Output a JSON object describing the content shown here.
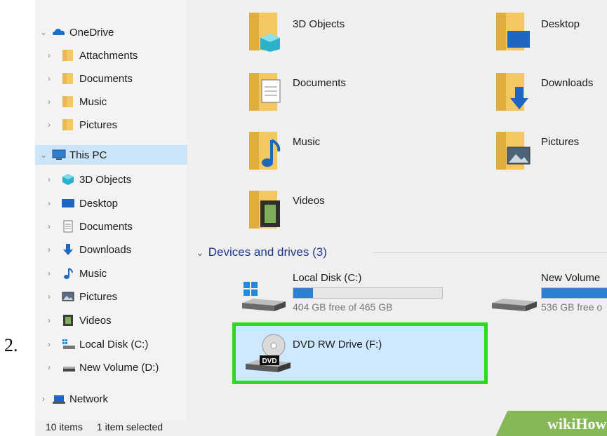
{
  "step_number": "2.",
  "nav": {
    "onedrive": "OneDrive",
    "onedrive_items": [
      "Attachments",
      "Documents",
      "Music",
      "Pictures"
    ],
    "this_pc": "This PC",
    "this_pc_items": [
      "3D Objects",
      "Desktop",
      "Documents",
      "Downloads",
      "Music",
      "Pictures",
      "Videos",
      "Local Disk (C:)",
      "New Volume (D:)"
    ],
    "network": "Network"
  },
  "status": {
    "items": "10 items",
    "selected": "1 item selected"
  },
  "folders": [
    {
      "name": "3D Objects"
    },
    {
      "name": "Desktop"
    },
    {
      "name": "Documents"
    },
    {
      "name": "Downloads"
    },
    {
      "name": "Music"
    },
    {
      "name": "Pictures"
    },
    {
      "name": "Videos"
    }
  ],
  "devices": {
    "header": "Devices and drives (3)",
    "drives": [
      {
        "name": "Local Disk (C:)",
        "free": "404 GB free of 465 GB",
        "used_fraction": 0.13
      },
      {
        "name": "New Volume",
        "free": "536 GB free o",
        "used_fraction": 0.85
      },
      {
        "name": "DVD RW Drive (F:)",
        "selected": true
      }
    ]
  },
  "watermark": {
    "part1": "wiki",
    "part2": "How"
  },
  "colors": {
    "selection": "#cde8ff",
    "highlight_border": "#2ddb1a",
    "nav_selected": "#cce4f7",
    "drive_bar": "#2b7fd6"
  }
}
